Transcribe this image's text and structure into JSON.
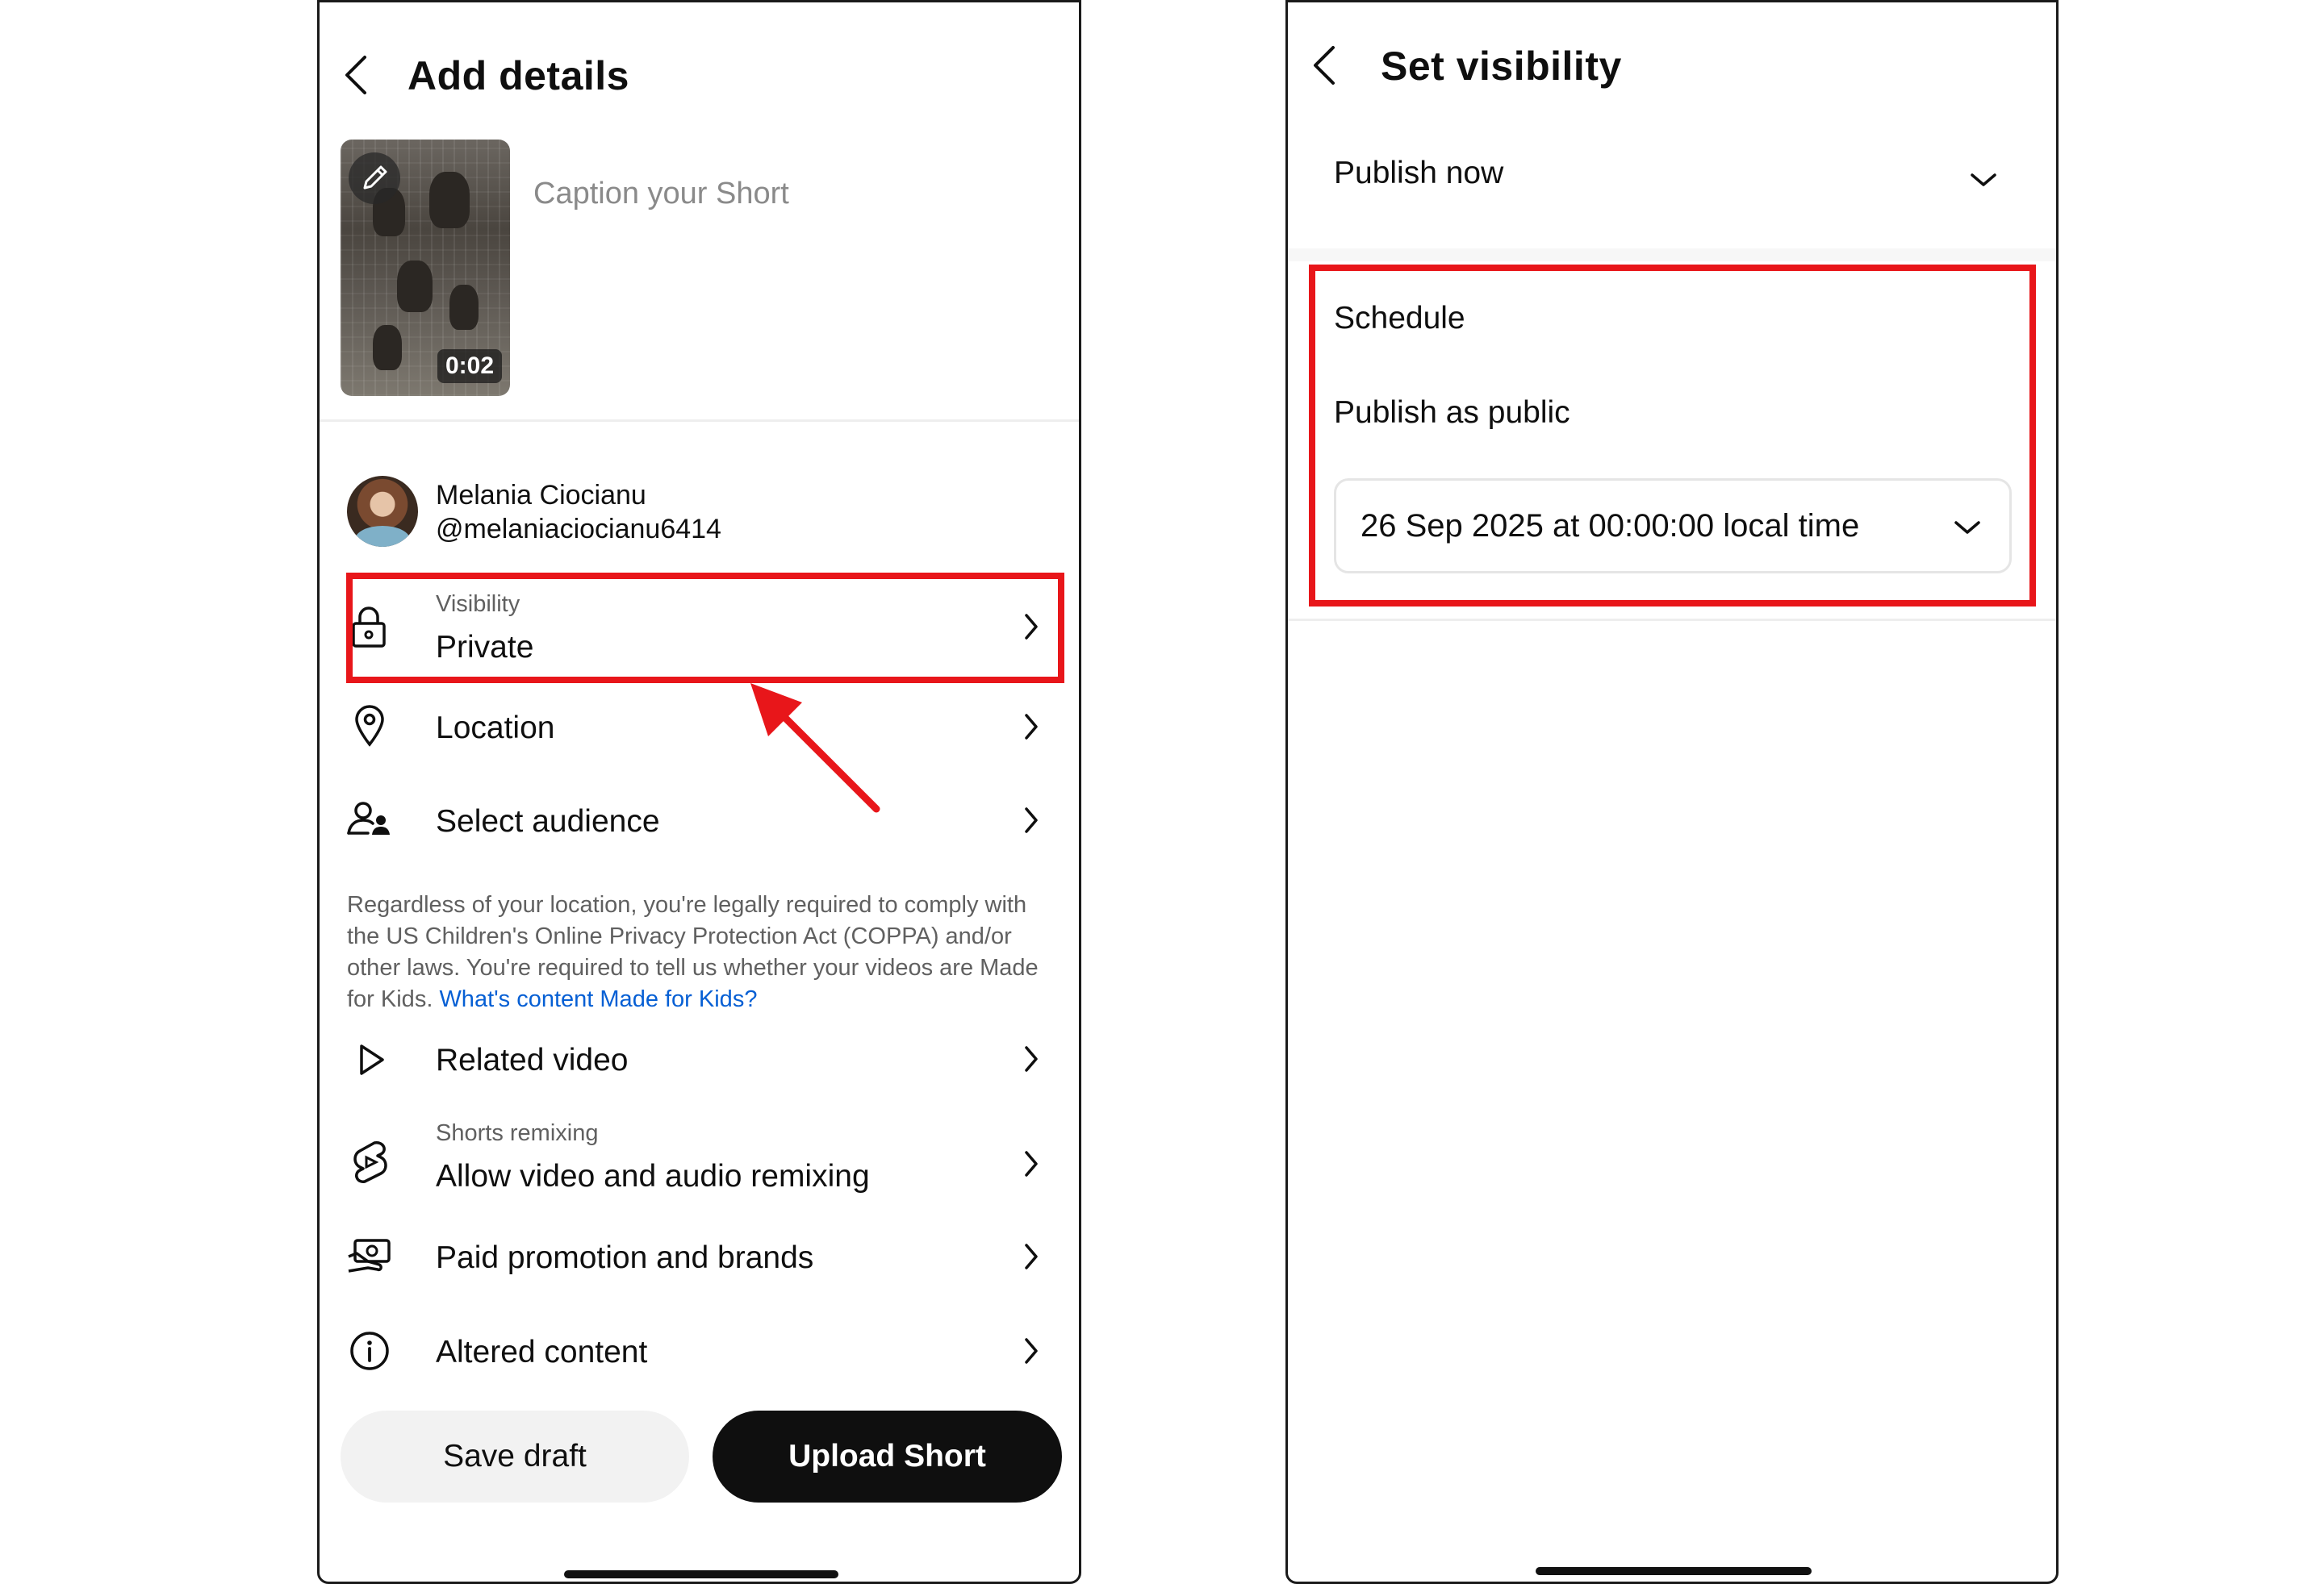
{
  "left": {
    "title": "Add details",
    "caption_placeholder": "Caption your Short",
    "video_duration": "0:02",
    "account": {
      "name": "Melania Ciocianu",
      "handle": "@melaniaciocianu6414"
    },
    "visibility": {
      "label": "Visibility",
      "value": "Private"
    },
    "location_label": "Location",
    "audience_label": "Select audience",
    "coppa_note": "Regardless of your location, you're legally required to comply with the US Children's Online Privacy Protection Act (COPPA) and/or other laws. You're required to tell us whether your videos are Made for Kids.",
    "coppa_link": "What's content Made for Kids?",
    "related_video_label": "Related video",
    "remixing": {
      "label": "Shorts remixing",
      "value": "Allow video and audio remixing"
    },
    "paid_promotion_label": "Paid promotion and brands",
    "altered_content_label": "Altered content",
    "save_draft_label": "Save draft",
    "upload_label": "Upload Short"
  },
  "right": {
    "title": "Set visibility",
    "publish_option": "Publish now",
    "schedule_label": "Schedule",
    "publish_public_label": "Publish as public",
    "schedule_datetime": "26 Sep 2025 at 00:00:00 local time"
  },
  "colors": {
    "highlight": "#e8161a",
    "link": "#065fd4",
    "primary_button": "#0f0f0f"
  }
}
